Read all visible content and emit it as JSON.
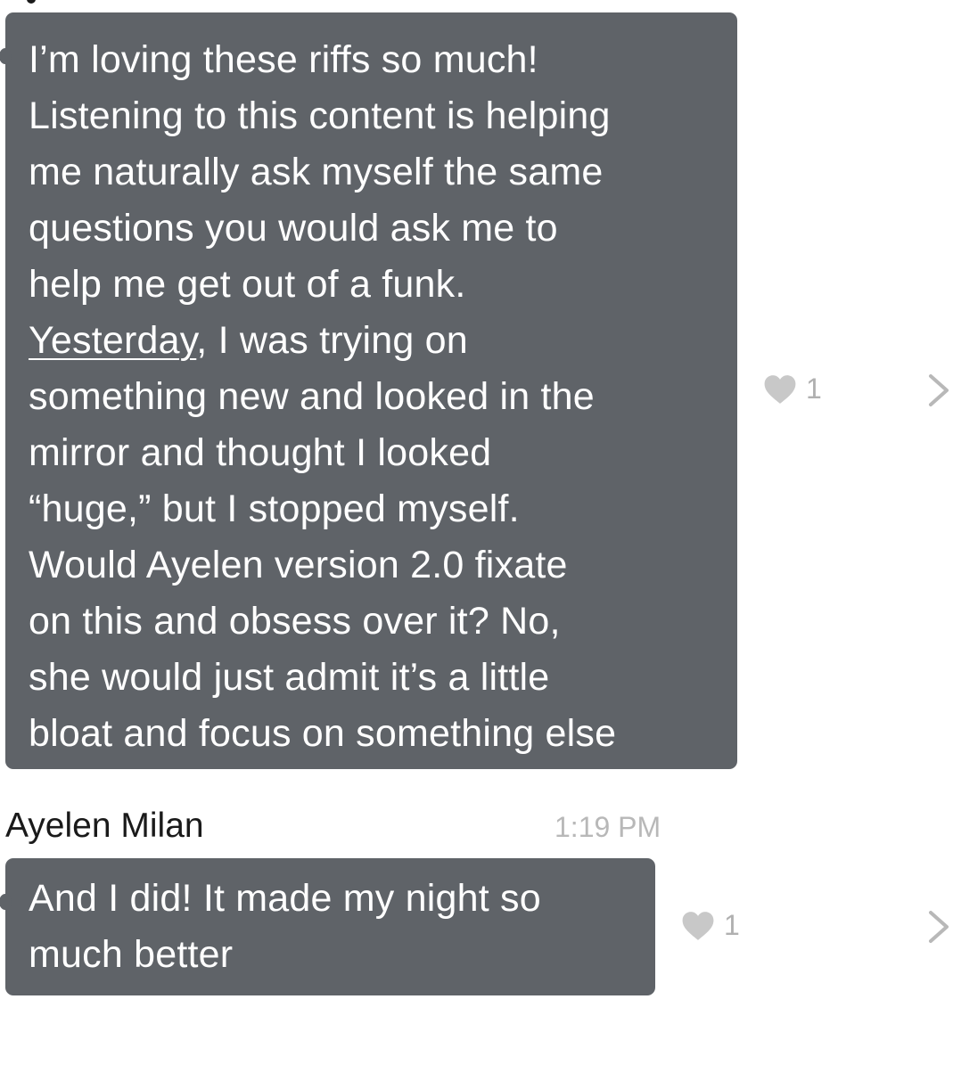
{
  "messages": [
    {
      "lines_before_link": [
        "I’m loving these riffs so much!",
        "Listening to this content is helping",
        "me naturally ask myself the same",
        "questions you would ask me to",
        "help me get out of a funk."
      ],
      "link_word": "Yesterday",
      "link_rest": ", I was trying on",
      "lines_after_link": [
        "something new and looked in the",
        "mirror and thought I looked",
        "“huge,” but I stopped myself.",
        "Would Ayelen version 2.0 fixate",
        "on this and obsess over it? No,",
        "she would just admit it’s a little",
        "bloat and focus on something else"
      ],
      "likes": "1",
      "like_icon": "heart-icon",
      "detail_icon": "chevron-right-icon"
    },
    {
      "sender": "Ayelen Milan",
      "time": "1:19 PM",
      "lines": [
        "And I did! It made my night so",
        "much better"
      ],
      "likes": "1",
      "like_icon": "heart-icon",
      "detail_icon": "chevron-right-icon"
    }
  ],
  "colors": {
    "bubble": "#5f6368",
    "bubble_text": "#ffffff",
    "meta_text": "#b0b0b0"
  }
}
